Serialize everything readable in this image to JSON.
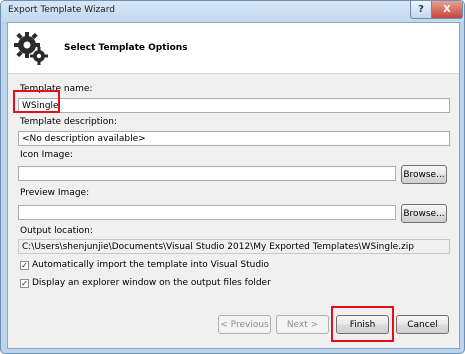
{
  "window": {
    "title": "Export Template Wizard",
    "help_label": "?",
    "close_label": "X"
  },
  "header": {
    "title": "Select Template Options",
    "icon": "gear-icon"
  },
  "form": {
    "template_name_label": "Template name:",
    "template_name_value": "WSingle",
    "template_description_label": "Template description:",
    "template_description_value": "<No description available>",
    "icon_image_label": "Icon Image:",
    "icon_image_value": "",
    "icon_browse_label": "Browse...",
    "preview_image_label": "Preview Image:",
    "preview_image_value": "",
    "preview_browse_label": "Browse...",
    "output_location_label": "Output location:",
    "output_location_value": "C:\\Users\\shenjunjie\\Documents\\Visual Studio 2012\\My Exported Templates\\WSingle.zip",
    "auto_import_label": "Automatically import the template into Visual Studio",
    "auto_import_checked": true,
    "display_explorer_label": "Display an explorer window on the output files folder",
    "display_explorer_checked": true
  },
  "footer": {
    "previous_label": "< Previous",
    "next_label": "Next >",
    "finish_label": "Finish",
    "cancel_label": "Cancel"
  },
  "check_mark": "✓",
  "colors": {
    "highlight": "#e3101b",
    "window_frame": "#bcd3eb"
  }
}
